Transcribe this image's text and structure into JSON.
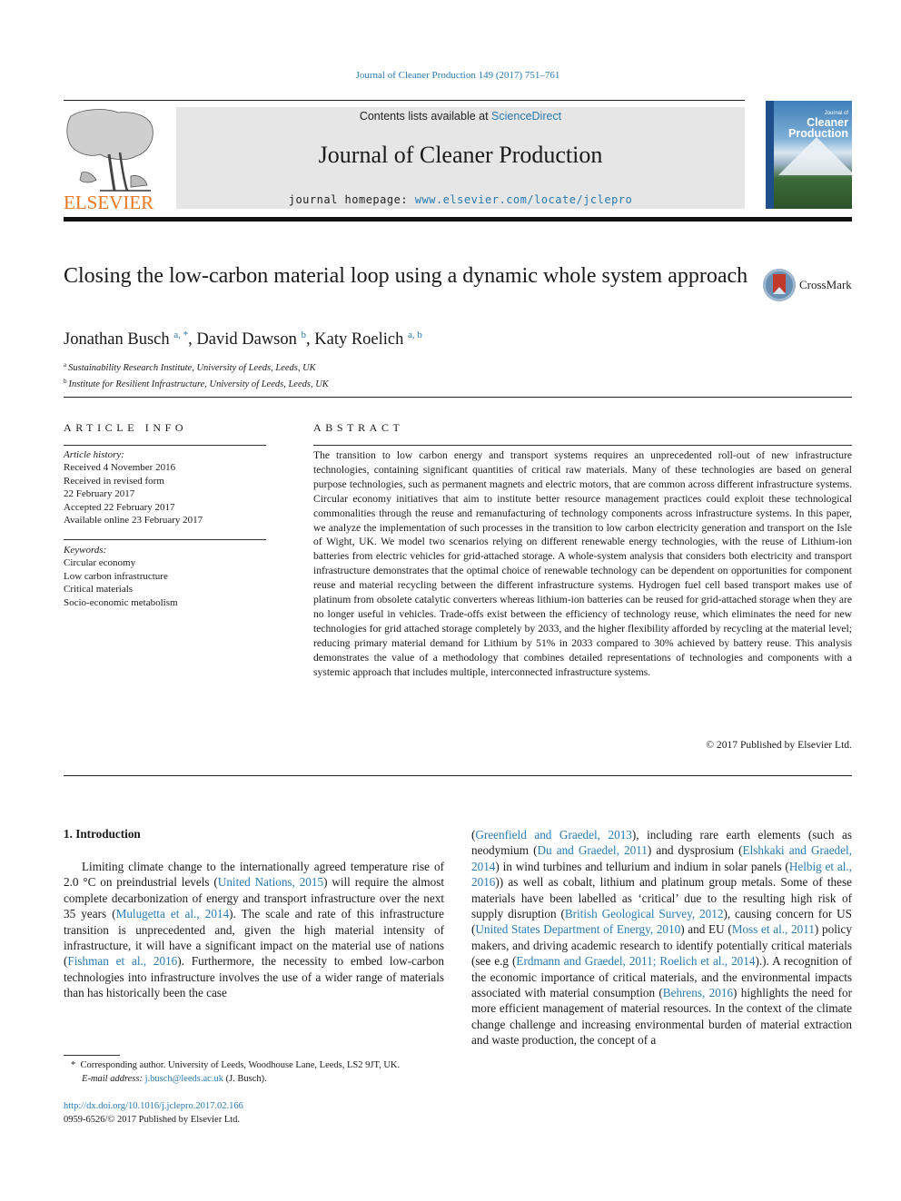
{
  "running_head": "Journal of Cleaner Production 149 (2017) 751–761",
  "publisher": {
    "name": "ELSEVIER",
    "color": "#e87722",
    "logo_icon": "elsevier-tree-icon"
  },
  "masthead": {
    "contents_prefix": "Contents lists available at ",
    "contents_link": "ScienceDirect",
    "journal_title": "Journal of Cleaner Production",
    "homepage_prefix": "journal homepage: ",
    "homepage_link": "www.elsevier.com/locate/jclepro",
    "background": "#e6e6e6",
    "link_color": "#2a7ab0"
  },
  "cover": {
    "small_title": "Journal of",
    "title_line1": "Cleaner",
    "title_line2": "Production"
  },
  "article": {
    "title": "Closing the low-carbon material loop using a dynamic whole system approach",
    "crossmark_label": "CrossMark",
    "authors": [
      {
        "name": "Jonathan Busch",
        "sup": "a, *",
        "sep": ", "
      },
      {
        "name": "David Dawson",
        "sup": "b",
        "sep": ", "
      },
      {
        "name": "Katy Roelich",
        "sup": "a, b",
        "sep": ""
      }
    ],
    "affiliations": [
      {
        "key": "a",
        "text": "Sustainability Research Institute, University of Leeds, Leeds, UK"
      },
      {
        "key": "b",
        "text": "Institute for Resilient Infrastructure, University of Leeds, Leeds, UK"
      }
    ]
  },
  "article_info": {
    "heading": "ARTICLE INFO",
    "history_label": "Article history:",
    "history": [
      "Received 4 November 2016",
      "Received in revised form",
      "22 February 2017",
      "Accepted 22 February 2017",
      "Available online 23 February 2017"
    ],
    "keywords_label": "Keywords:",
    "keywords": [
      "Circular economy",
      "Low carbon infrastructure",
      "Critical materials",
      "Socio-economic metabolism"
    ]
  },
  "abstract": {
    "heading": "ABSTRACT",
    "text": "The transition to low carbon energy and transport systems requires an unprecedented roll-out of new infrastructure technologies, containing significant quantities of critical raw materials. Many of these technologies are based on general purpose technologies, such as permanent magnets and electric motors, that are common across different infrastructure systems. Circular economy initiatives that aim to institute better resource management practices could exploit these technological commonalities through the reuse and remanufacturing of technology components across infrastructure systems. In this paper, we analyze the implementation of such processes in the transition to low carbon electricity generation and transport on the Isle of Wight, UK. We model two scenarios relying on different renewable energy technologies, with the reuse of Lithium-ion batteries from electric vehicles for grid-attached storage. A whole-system analysis that considers both electricity and transport infrastructure demonstrates that the optimal choice of renewable technology can be dependent on opportunities for component reuse and material recycling between the different infrastructure systems. Hydrogen fuel cell based transport makes use of platinum from obsolete catalytic converters whereas lithium-ion batteries can be reused for grid-attached storage when they are no longer useful in vehicles. Trade-offs exist between the efficiency of technology reuse, which eliminates the need for new technologies for grid attached storage completely by 2033, and the higher flexibility afforded by recycling at the material level; reducing primary material demand for Lithium by 51% in 2033 compared to 30% achieved by battery reuse. This analysis demonstrates the value of a methodology that combines detailed representations of technologies and components with a systemic approach that includes multiple, interconnected infrastructure systems.",
    "copyright": "© 2017 Published by Elsevier Ltd."
  },
  "introduction": {
    "heading": "1.  Introduction",
    "left_column": [
      {
        "t": "Limiting climate change to the internationally agreed temperature rise of 2.0 °C on preindustrial levels ("
      },
      {
        "t": "United Nations, 2015",
        "link": true
      },
      {
        "t": ") will require the almost complete decarbonization of energy and transport infrastructure over the next 35 years ("
      },
      {
        "t": "Mulugetta et al., 2014",
        "link": true
      },
      {
        "t": "). The scale and rate of this infrastructure transition is unprecedented and, given the high material intensity of infrastructure, it will have a significant impact on the material use of nations ("
      },
      {
        "t": "Fishman et al., 2016",
        "link": true
      },
      {
        "t": "). Furthermore, the necessity to embed low-carbon technologies into infrastructure involves the use of a wider range of materials than has historically been the case"
      }
    ],
    "right_column": [
      {
        "t": "("
      },
      {
        "t": "Greenfield and Graedel, 2013",
        "link": true
      },
      {
        "t": "), including rare earth elements (such as neodymium ("
      },
      {
        "t": "Du and Graedel, 2011",
        "link": true
      },
      {
        "t": ") and dysprosium ("
      },
      {
        "t": "Elshkaki and Graedel, 2014",
        "link": true
      },
      {
        "t": ") in wind turbines and tellurium and indium in solar panels ("
      },
      {
        "t": "Helbig et al., 2016",
        "link": true
      },
      {
        "t": ")) as well as cobalt, lithium and platinum group metals. Some of these materials have been labelled as ‘critical’ due to the resulting high risk of supply disruption ("
      },
      {
        "t": "British Geological Survey, 2012",
        "link": true
      },
      {
        "t": "), causing concern for US ("
      },
      {
        "t": "United States Department of Energy, 2010",
        "link": true
      },
      {
        "t": ") and EU ("
      },
      {
        "t": "Moss et al., 2011",
        "link": true
      },
      {
        "t": ") policy makers, and driving academic research to identify potentially critical materials (see e.g ("
      },
      {
        "t": "Erdmann and Graedel, 2011; Roelich et al., 2014",
        "link": true
      },
      {
        "t": ").). A recognition of the economic importance of critical materials, and the environmental impacts associated with material consumption ("
      },
      {
        "t": "Behrens, 2016",
        "link": true
      },
      {
        "t": ") highlights the need for more efficient management of material resources. In the context of the climate change challenge and increasing environmental burden of material extraction and waste production, the concept of a"
      }
    ]
  },
  "footnote": {
    "marker": "*",
    "corresponding": "Corresponding author. University of Leeds, Woodhouse Lane, Leeds, LS2 9JT, UK.",
    "email_label": "E-mail address:",
    "email": "j.busch@leeds.ac.uk",
    "email_suffix": " (J. Busch)."
  },
  "doi": {
    "link": "http://dx.doi.org/10.1016/j.jclepro.2017.02.166",
    "issn_line": "0959-6526/© 2017 Published by Elsevier Ltd."
  }
}
